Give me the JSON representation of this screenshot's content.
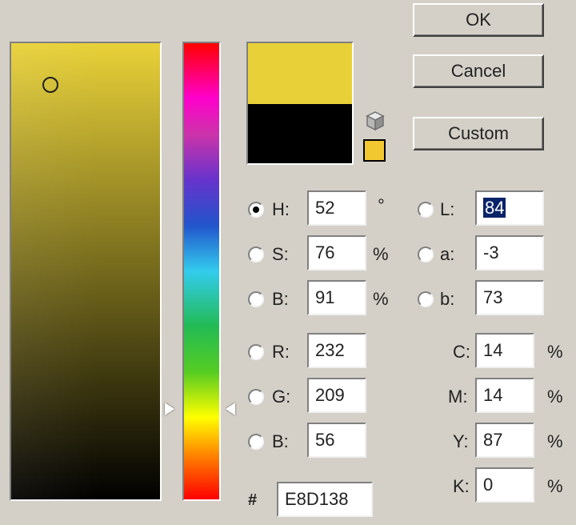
{
  "buttons": {
    "ok": "OK",
    "cancel": "Cancel",
    "custom": "Custom"
  },
  "colors": {
    "new": "#e8d138",
    "current": "#000000",
    "websafe": "#f2c830"
  },
  "hsb": {
    "h": {
      "label": "H:",
      "value": "52",
      "unit": "°",
      "selected": true
    },
    "s": {
      "label": "S:",
      "value": "76",
      "unit": "%"
    },
    "b": {
      "label": "B:",
      "value": "91",
      "unit": "%"
    }
  },
  "lab": {
    "l": {
      "label": "L:",
      "value": "84"
    },
    "a": {
      "label": "a:",
      "value": "-3"
    },
    "b": {
      "label": "b:",
      "value": "73"
    }
  },
  "rgb": {
    "r": {
      "label": "R:",
      "value": "232"
    },
    "g": {
      "label": "G:",
      "value": "209"
    },
    "b": {
      "label": "B:",
      "value": "56"
    }
  },
  "cmyk": {
    "c": {
      "label": "C:",
      "value": "14",
      "unit": "%"
    },
    "m": {
      "label": "M:",
      "value": "14",
      "unit": "%"
    },
    "y": {
      "label": "Y:",
      "value": "87",
      "unit": "%"
    },
    "k": {
      "label": "K:",
      "value": "0",
      "unit": "%"
    }
  },
  "hex": {
    "label": "#",
    "value": "E8D138"
  },
  "icons": {
    "gamut": "cube-icon",
    "picker": "circle-marker-icon",
    "slider": "triangle-arrow-icon"
  }
}
